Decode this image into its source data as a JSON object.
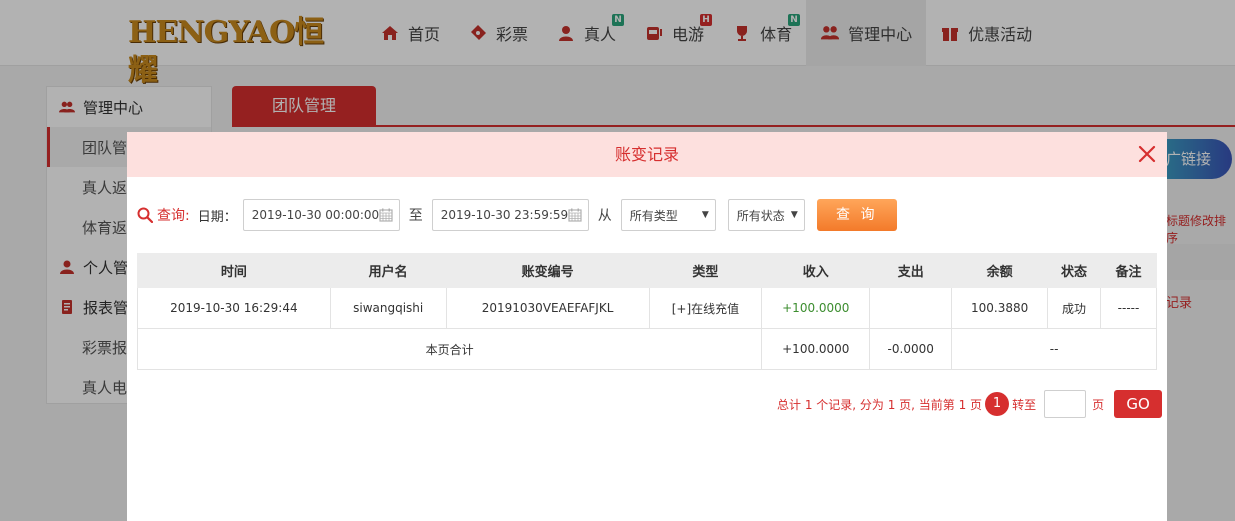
{
  "brand": {
    "logo_text": "HENGYAO恒耀"
  },
  "nav": {
    "items": [
      {
        "label": "首页",
        "badge": ""
      },
      {
        "label": "彩票",
        "badge": ""
      },
      {
        "label": "真人",
        "badge": "N"
      },
      {
        "label": "电游",
        "badge": "H"
      },
      {
        "label": "体育",
        "badge": "N"
      },
      {
        "label": "管理中心",
        "badge": ""
      },
      {
        "label": "优惠活动",
        "badge": ""
      }
    ]
  },
  "sidebar": {
    "items": [
      {
        "label": "管理中心"
      },
      {
        "label": "团队管"
      },
      {
        "label": "真人返"
      },
      {
        "label": "体育返"
      },
      {
        "label": "个人管"
      },
      {
        "label": "报表管"
      },
      {
        "label": "彩票报"
      },
      {
        "label": "真人电"
      }
    ]
  },
  "page": {
    "tab_label": "团队管理",
    "link_button": "广链接",
    "side_text_1": "标题修改排序",
    "side_text_2": "记录"
  },
  "modal": {
    "title": "账变记录",
    "query": {
      "label": "查询:",
      "date_label": "日期：",
      "start": "2019-10-30 00:00:00",
      "to_label": "至",
      "end": "2019-10-30 23:59:59",
      "from_label": "从",
      "type_select": "所有类型",
      "status_select": "所有状态",
      "search_button": "查 询"
    },
    "table": {
      "headers": [
        "时间",
        "用户名",
        "账变编号",
        "类型",
        "收入",
        "支出",
        "余额",
        "状态",
        "备注"
      ],
      "rows": [
        {
          "time": "2019-10-30 16:29:44",
          "username": "siwangqishi",
          "serial": "20191030VEAEFAFJKL",
          "type": "[+]在线充值",
          "income": "+100.0000",
          "expense": "",
          "balance": "100.3880",
          "status": "成功",
          "note": "-----"
        }
      ],
      "summary": {
        "label": "本页合计",
        "income": "+100.0000",
        "expense": "-0.0000",
        "rest": "--"
      }
    },
    "pager": {
      "summary_text": "总计 1 个记录, 分为 1 页, 当前第 1 页",
      "current_page": "1",
      "jump_label": "转至",
      "page_unit": "页",
      "go_label": "GO"
    }
  },
  "colors": {
    "accent": "#d62f2f",
    "header_bg": "#fde0de",
    "search_button": "#f37a2a",
    "income": "#3c8d2f"
  }
}
